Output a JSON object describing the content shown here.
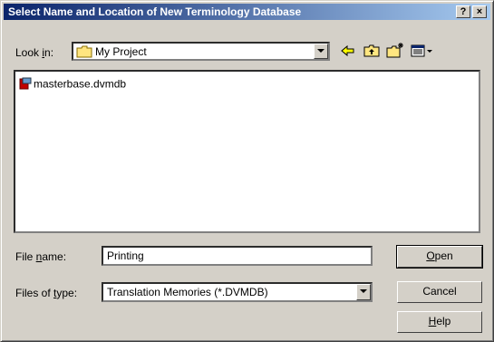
{
  "window": {
    "title": "Select Name and Location of New Terminology Database",
    "help_button": "?",
    "close_button": "×"
  },
  "look_in": {
    "label_prefix": "Look ",
    "label_accel": "i",
    "label_suffix": "n:",
    "value": "My Project",
    "icon": "folder-icon"
  },
  "toolbar": {
    "icons": [
      "back-arrow-icon",
      "up-folder-icon",
      "new-folder-icon",
      "view-menu-icon"
    ]
  },
  "file_list": {
    "items": [
      {
        "name": "masterbase.dvmdb",
        "icon": "database-file-icon"
      }
    ]
  },
  "file_name": {
    "label_prefix": "File ",
    "label_accel": "n",
    "label_suffix": "ame:",
    "value": "Printing"
  },
  "file_type": {
    "label_prefix": "Files of ",
    "label_accel": "t",
    "label_suffix": "ype:",
    "value": "Translation Memories (*.DVMDB)"
  },
  "buttons": {
    "open_accel": "O",
    "open_rest": "pen",
    "cancel": "Cancel",
    "help_accel": "H",
    "help_rest": "elp"
  },
  "colors": {
    "titlebar_start": "#0a246a",
    "titlebar_end": "#a6caf0",
    "face": "#d4d0c8"
  }
}
